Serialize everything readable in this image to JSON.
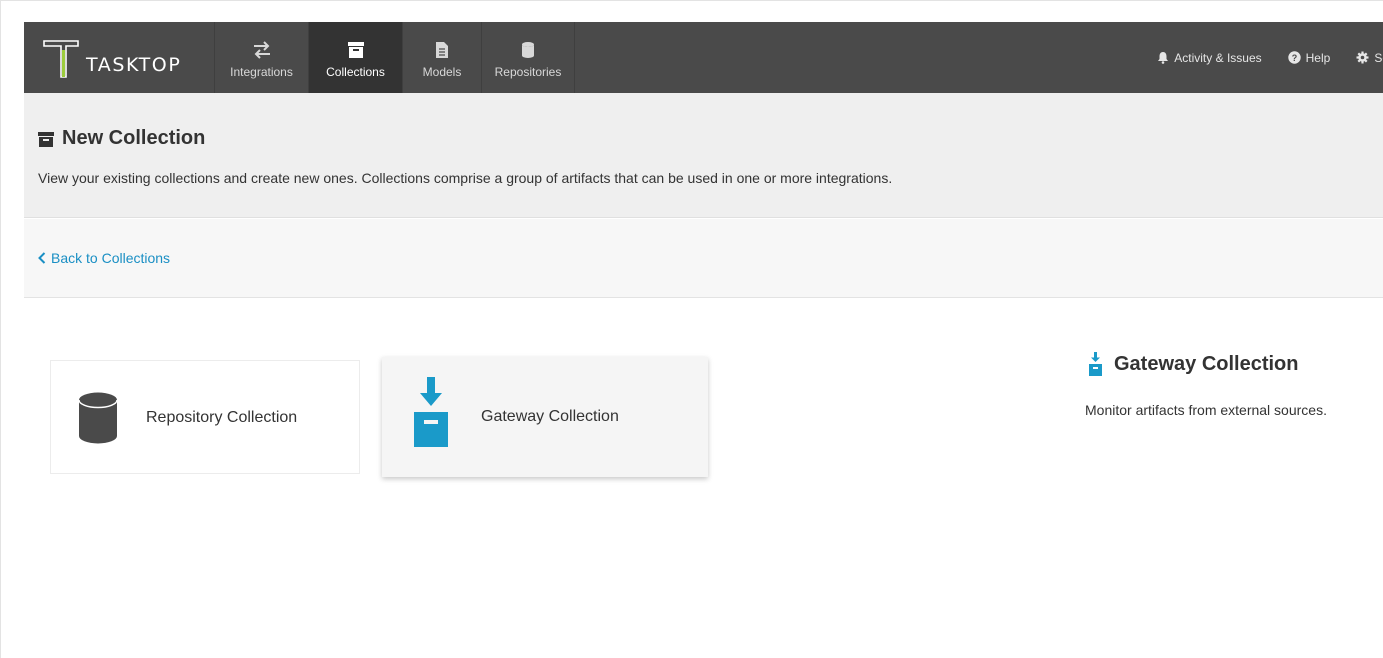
{
  "brand": {
    "name": "TASKTOP",
    "logo_icon": "tasktop-logo"
  },
  "nav": {
    "items": [
      {
        "label": "Integrations",
        "icon": "arrows-exchange-icon",
        "active": false
      },
      {
        "label": "Collections",
        "icon": "archive-box-icon",
        "active": true
      },
      {
        "label": "Models",
        "icon": "document-icon",
        "active": false
      },
      {
        "label": "Repositories",
        "icon": "database-icon",
        "active": false
      }
    ],
    "right": [
      {
        "label": "Activity & Issues",
        "icon": "bell-icon"
      },
      {
        "label": "Help",
        "icon": "question-circle-icon"
      },
      {
        "label": "Se",
        "icon": "gear-icon"
      }
    ]
  },
  "header": {
    "title": "New Collection",
    "title_icon": "archive-box-icon",
    "description": "View your existing collections and create new ones. Collections comprise a group of artifacts that can be used in one or more integrations."
  },
  "back": {
    "label": "Back to Collections",
    "icon": "chevron-left-icon"
  },
  "options": [
    {
      "label": "Repository Collection",
      "icon": "database-icon",
      "selected": false
    },
    {
      "label": "Gateway Collection",
      "icon": "gateway-inbox-icon",
      "selected": true
    }
  ],
  "info": {
    "title": "Gateway Collection",
    "description": "Monitor artifacts from external sources."
  },
  "colors": {
    "navbar": "#4a4a4a",
    "nav_active": "#333333",
    "accent": "#1a9ac9",
    "link": "#1a8fc4",
    "header_bg": "#efefef"
  }
}
